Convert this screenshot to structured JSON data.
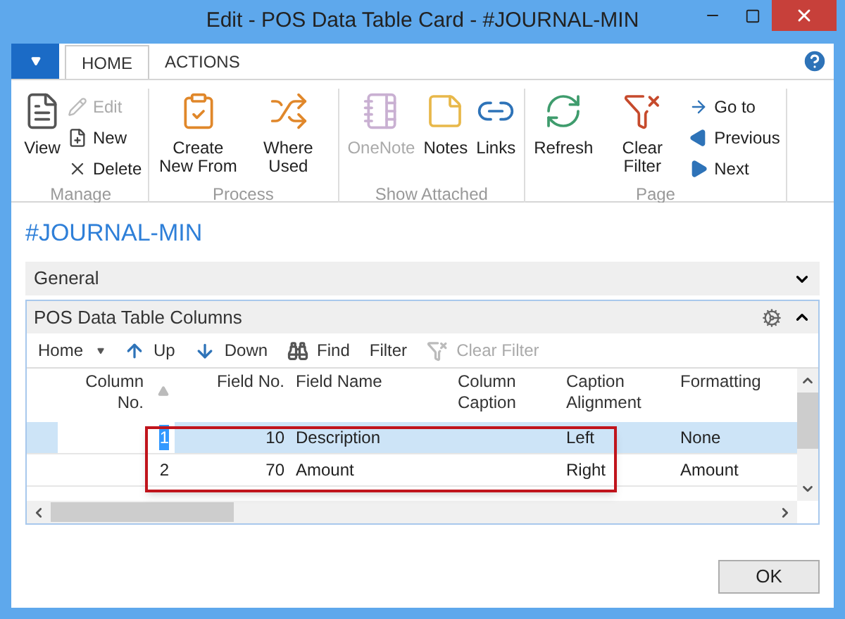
{
  "window": {
    "title": "Edit - POS Data Table Card - #JOURNAL-MIN"
  },
  "tabs": [
    {
      "label": "HOME",
      "selected": true
    },
    {
      "label": "ACTIONS",
      "selected": false
    }
  ],
  "ribbon": {
    "groups": [
      {
        "name": "Manage",
        "items": [
          {
            "label": "View",
            "kind": "large",
            "disabled": false
          },
          {
            "label": "Edit",
            "kind": "small",
            "disabled": true
          },
          {
            "label": "New",
            "kind": "small",
            "disabled": false
          },
          {
            "label": "Delete",
            "kind": "small",
            "disabled": false
          }
        ]
      },
      {
        "name": "Process",
        "items": [
          {
            "label": "Create New From",
            "kind": "large",
            "disabled": false
          },
          {
            "label": "Where Used",
            "kind": "large",
            "disabled": false
          }
        ]
      },
      {
        "name": "Show Attached",
        "items": [
          {
            "label": "OneNote",
            "kind": "large",
            "disabled": true
          },
          {
            "label": "Notes",
            "kind": "large",
            "disabled": false
          },
          {
            "label": "Links",
            "kind": "large",
            "disabled": false
          }
        ]
      },
      {
        "name": "Page",
        "items": [
          {
            "label": "Refresh",
            "kind": "large",
            "disabled": false
          },
          {
            "label": "Clear Filter",
            "kind": "large",
            "disabled": false
          },
          {
            "label": "Go to",
            "kind": "small",
            "disabled": false
          },
          {
            "label": "Previous",
            "kind": "small",
            "disabled": false
          },
          {
            "label": "Next",
            "kind": "small",
            "disabled": false
          }
        ]
      }
    ]
  },
  "page_title": "#JOURNAL-MIN",
  "general": {
    "title": "General",
    "expanded": false
  },
  "part": {
    "title": "POS Data Table Columns",
    "expanded": true,
    "toolbar": [
      {
        "label": "Home",
        "kind": "menu",
        "disabled": false
      },
      {
        "label": "Up",
        "kind": "button",
        "disabled": false
      },
      {
        "label": "Down",
        "kind": "button",
        "disabled": false
      },
      {
        "label": "Find",
        "kind": "button",
        "disabled": false
      },
      {
        "label": "Filter",
        "kind": "button",
        "disabled": false
      },
      {
        "label": "Clear Filter",
        "kind": "button",
        "disabled": true
      }
    ],
    "columns": [
      {
        "label": "Column No.",
        "sorted": true
      },
      {
        "label": "Field No.",
        "sorted": false
      },
      {
        "label": "Field Name",
        "sorted": false
      },
      {
        "label": "Column Caption",
        "sorted": false
      },
      {
        "label": "Caption Alignment",
        "sorted": false
      },
      {
        "label": "Formatting",
        "sorted": false
      }
    ],
    "rows": [
      {
        "selected": true,
        "cells": [
          "1",
          "10",
          "Description",
          "",
          "Left",
          "None"
        ]
      },
      {
        "selected": false,
        "cells": [
          "2",
          "70",
          "Amount",
          "",
          "Right",
          "Amount"
        ]
      }
    ]
  },
  "buttons": [
    "OK"
  ]
}
